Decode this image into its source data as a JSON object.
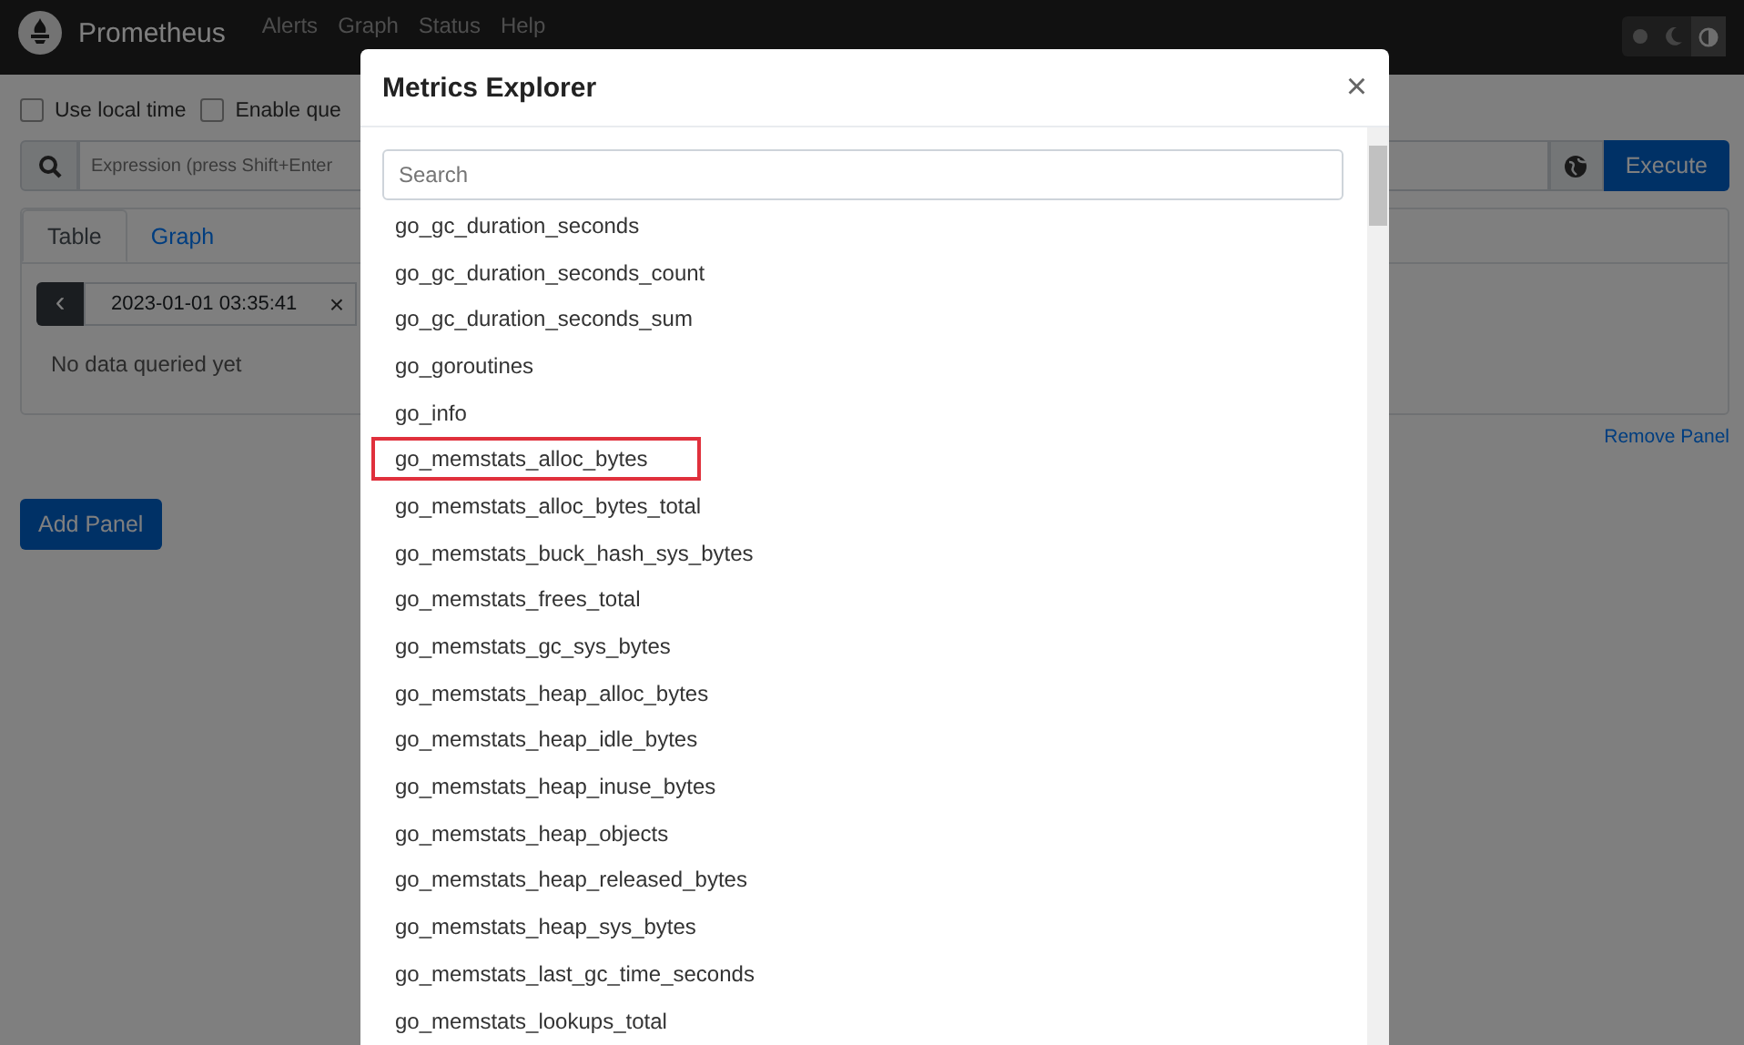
{
  "navbar": {
    "brand": "Prometheus",
    "links": [
      "Alerts",
      "Graph",
      "Status",
      "Help"
    ],
    "theme_buttons": [
      {
        "kind": "light",
        "selected": false
      },
      {
        "kind": "dark",
        "selected": false
      },
      {
        "kind": "auto",
        "selected": true
      }
    ]
  },
  "options": [
    {
      "label": "Use local time",
      "checked": false
    },
    {
      "label": "Enable que",
      "checked": false
    }
  ],
  "expression": {
    "placeholder": "Expression (press Shift+Enter",
    "execute": "Execute"
  },
  "panel": {
    "tabs": [
      {
        "label": "Table",
        "selected": true
      },
      {
        "label": "Graph",
        "selected": false
      }
    ],
    "time": "2023-01-01 03:35:41",
    "clear": "×",
    "prev": "‹",
    "empty": "No data queried yet",
    "remove": "Remove Panel"
  },
  "add_panel": "Add Panel",
  "modal": {
    "title": "Metrics Explorer",
    "close": "×",
    "search": {
      "placeholder": "Search"
    },
    "metrics": [
      {
        "name": "go_gc_duration_seconds",
        "highlighted": false
      },
      {
        "name": "go_gc_duration_seconds_count",
        "highlighted": false
      },
      {
        "name": "go_gc_duration_seconds_sum",
        "highlighted": false
      },
      {
        "name": "go_goroutines",
        "highlighted": false
      },
      {
        "name": "go_info",
        "highlighted": false
      },
      {
        "name": "go_memstats_alloc_bytes",
        "highlighted": true
      },
      {
        "name": "go_memstats_alloc_bytes_total",
        "highlighted": false
      },
      {
        "name": "go_memstats_buck_hash_sys_bytes",
        "highlighted": false
      },
      {
        "name": "go_memstats_frees_total",
        "highlighted": false
      },
      {
        "name": "go_memstats_gc_sys_bytes",
        "highlighted": false
      },
      {
        "name": "go_memstats_heap_alloc_bytes",
        "highlighted": false
      },
      {
        "name": "go_memstats_heap_idle_bytes",
        "highlighted": false
      },
      {
        "name": "go_memstats_heap_inuse_bytes",
        "highlighted": false
      },
      {
        "name": "go_memstats_heap_objects",
        "highlighted": false
      },
      {
        "name": "go_memstats_heap_released_bytes",
        "highlighted": false
      },
      {
        "name": "go_memstats_heap_sys_bytes",
        "highlighted": false
      },
      {
        "name": "go_memstats_last_gc_time_seconds",
        "highlighted": false
      },
      {
        "name": "go_memstats_lookups_total",
        "highlighted": false
      }
    ]
  }
}
